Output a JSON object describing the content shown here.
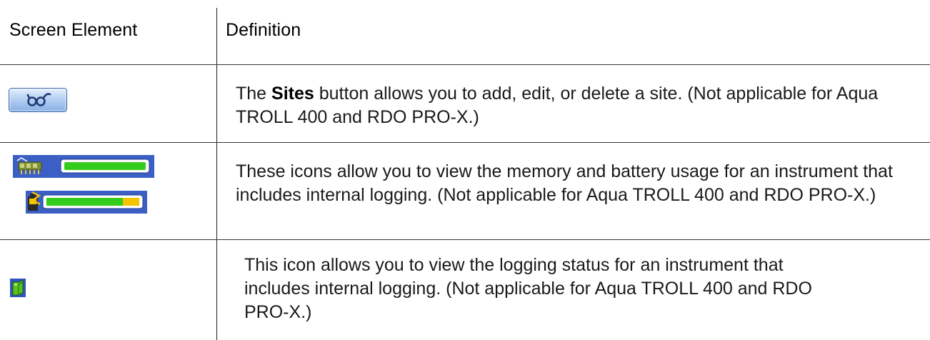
{
  "table": {
    "headers": {
      "element": "Screen Element",
      "definition": "Definition"
    },
    "rows": [
      {
        "icon": "sites-button-icon",
        "definition_prefix": "The ",
        "definition_bold": "Sites",
        "definition_rest": " button allows you to add, edit, or delete a site. (Not applicable for Aqua TROLL 400 and RDO PRO-X.)"
      },
      {
        "icons": [
          "memory-usage-icon",
          "battery-usage-icon"
        ],
        "memory_level": 1.0,
        "battery_level": 0.8,
        "definition": "These icons allow you to view the memory and battery usage for an instrument that includes internal logging. (Not applicable for Aqua TROLL 400 and RDO PRO-X.)"
      },
      {
        "icon": "logging-status-icon",
        "definition": "This icon allows you to view the logging status for an instrument that includes internal logging. (Not applicable for Aqua TROLL 400 and RDO PRO-X.)"
      }
    ]
  },
  "colors": {
    "toolbar_blue": "#3b5fc4",
    "bar_green": "#33cc1a",
    "bar_yellow": "#f5c400",
    "button_face": "#a9c6ee"
  }
}
